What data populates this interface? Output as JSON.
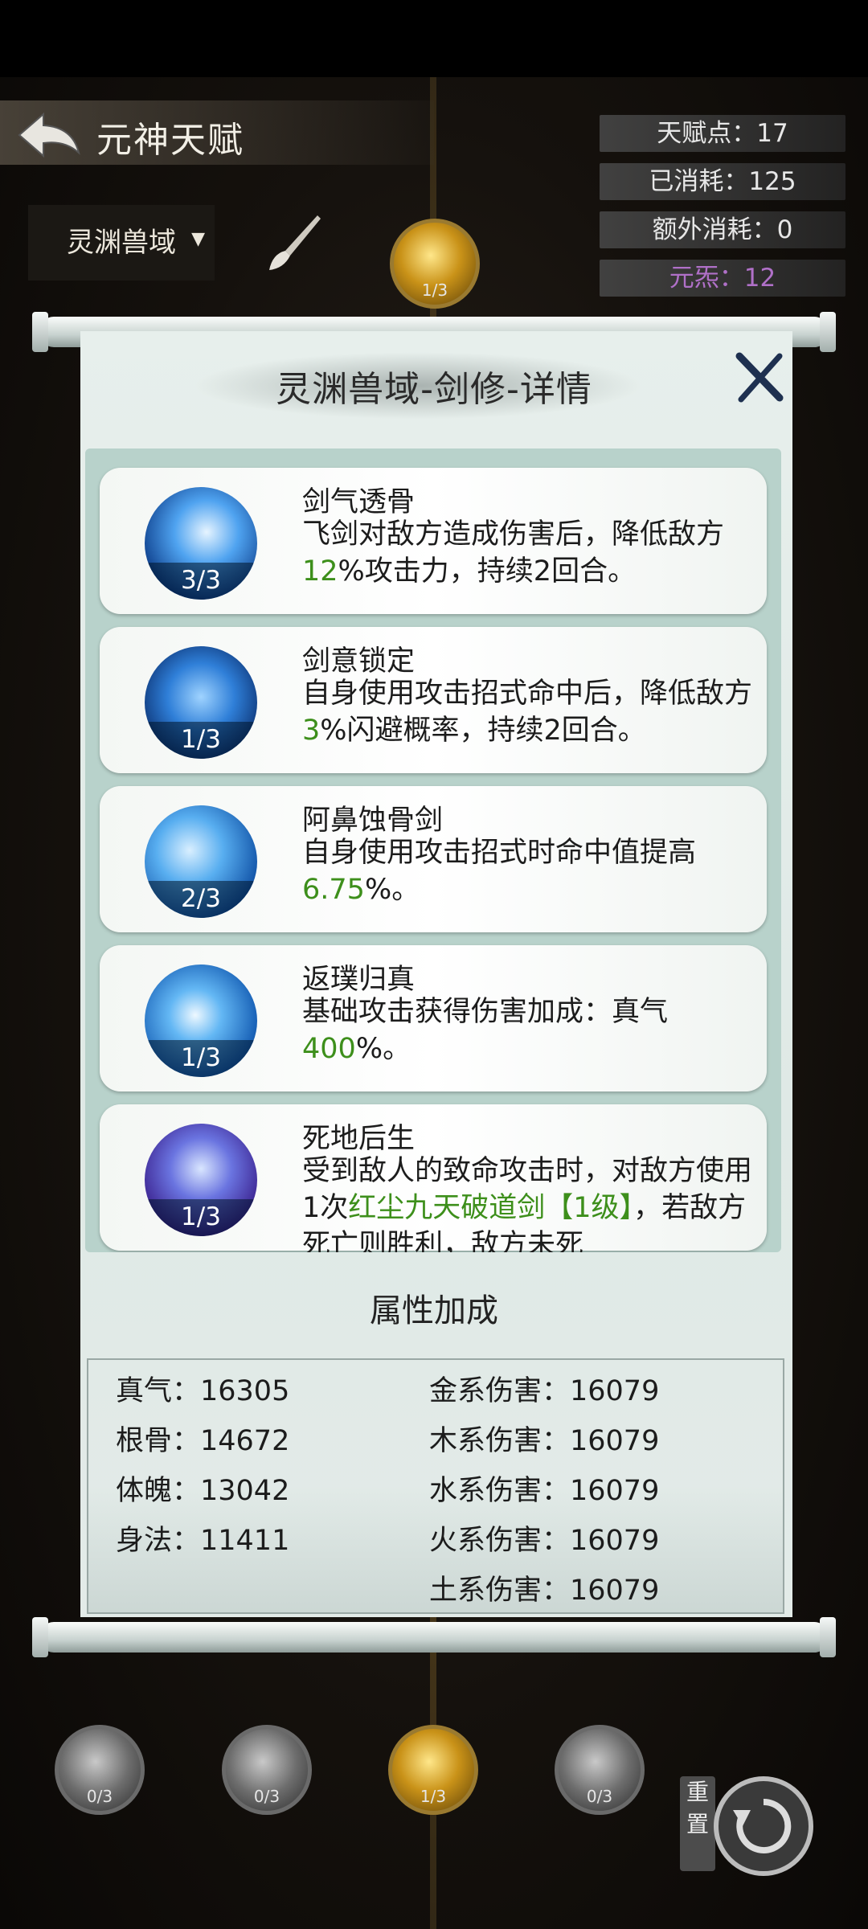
{
  "header": {
    "title": "元神天赋"
  },
  "stats": [
    {
      "label": "天赋点：17"
    },
    {
      "label": "已消耗：125"
    },
    {
      "label": "额外消耗：0"
    },
    {
      "label": "元炁：12"
    }
  ],
  "region_tab": {
    "label": "灵渊兽域",
    "arrow": "▼"
  },
  "top_node": {
    "level": "1/3"
  },
  "bottom_nodes": [
    {
      "level": "0/3"
    },
    {
      "level": "0/3"
    },
    {
      "level": "1/3"
    },
    {
      "level": "0/3"
    }
  ],
  "reset": {
    "label": "重置"
  },
  "modal": {
    "title": "灵渊兽域-剑修-详情",
    "skills": [
      {
        "name": "剑气透骨",
        "level": "3/3",
        "desc_a": "飞剑对敌方造成伤害后，降低敌方",
        "highlight": "12",
        "desc_b": "%攻击力，持续2回合。"
      },
      {
        "name": "剑意锁定",
        "level": "1/3",
        "desc_a": "自身使用攻击招式命中后，降低敌方",
        "highlight": "3",
        "desc_b": "%闪避概率，持续2回合。"
      },
      {
        "name": "阿鼻蚀骨剑",
        "level": "2/3",
        "desc_a": "自身使用攻击招式时命中值提高",
        "highlight": "6.75",
        "desc_b": "%。"
      },
      {
        "name": "返璞归真",
        "level": "1/3",
        "desc_a": "基础攻击获得伤害加成：真气",
        "highlight": "400",
        "desc_b": "%。"
      },
      {
        "name": "死地后生",
        "level": "1/3",
        "desc_a": "受到敌人的致命攻击时，对敌方使用1次",
        "highlight": "红尘九天破道剑【1级】",
        "desc_b": "，若敌方死亡则胜利，敌方未死"
      }
    ],
    "attr_title": "属性加成",
    "attrs_left": [
      "真气：16305",
      "根骨：14672",
      "体魄：13042",
      "身法：11411"
    ],
    "attrs_right": [
      "金系伤害：16079",
      "木系伤害：16079",
      "水系伤害：16079",
      "火系伤害：16079",
      "土系伤害：16079"
    ]
  }
}
